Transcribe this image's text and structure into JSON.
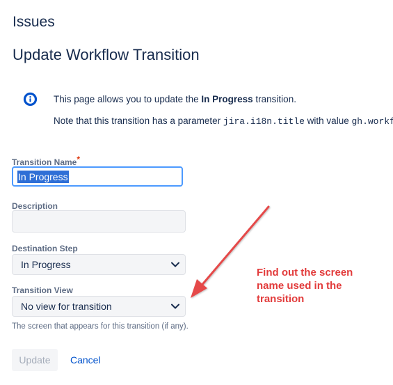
{
  "header": {
    "section_title": "Issues",
    "page_title": "Update Workflow Transition"
  },
  "info": {
    "icon": "info-circle-icon",
    "line1_prefix": "This page allows you to update the ",
    "line1_bold": "In Progress",
    "line1_suffix": " transition.",
    "line2_prefix": "Note that this transition has a parameter ",
    "line2_code1": "jira.i18n.title",
    "line2_middle": " with value ",
    "line2_code2": "gh.workf"
  },
  "form": {
    "transition_name_label": "Transition Name",
    "required_mark": "*",
    "transition_name_value": "In Progress",
    "description_label": "Description",
    "destination_step_label": "Destination Step",
    "destination_step_value": "In Progress",
    "transition_view_label": "Transition View",
    "transition_view_value": "No view for transition",
    "transition_view_help": "The screen that appears for this transition (if any).",
    "update_button": "Update",
    "cancel_link": "Cancel"
  },
  "annotation": {
    "text": "Find out the screen name used in the transition",
    "color": "#e23b3b"
  },
  "colors": {
    "focus_border": "#4c9aff",
    "selection": "#2f6fd6",
    "link": "#0052cc",
    "info_icon": "#0052cc"
  }
}
